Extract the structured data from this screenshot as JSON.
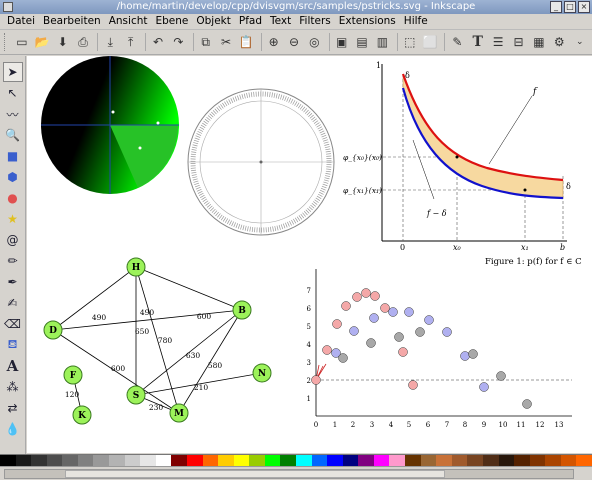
{
  "window": {
    "title": "/home/martin/develop/cpp/dvisvgm/src/samples/pstricks.svg - Inkscape"
  },
  "menu": [
    "Datei",
    "Bearbeiten",
    "Ansicht",
    "Ebene",
    "Objekt",
    "Pfad",
    "Text",
    "Filters",
    "Extensions",
    "Hilfe"
  ],
  "toolbar_icons": [
    "new-document-icon",
    "open-icon",
    "save-icon",
    "print-icon",
    "import-icon",
    "export-icon",
    "undo-icon",
    "redo-icon",
    "copy-icon",
    "cut-icon",
    "paste-icon",
    "zoom-selection-icon",
    "zoom-drawing-icon",
    "zoom-page-icon",
    "duplicate-icon",
    "clone-icon",
    "unlink-clone-icon",
    "group-icon",
    "ungroup-icon",
    "fill-stroke-icon",
    "text-icon",
    "layers-icon",
    "align-icon",
    "xml-editor-icon",
    "preferences-icon"
  ],
  "tools": [
    "selector-tool-icon",
    "node-tool-icon",
    "tweak-tool-icon",
    "zoom-tool-icon",
    "rectangle-tool-icon",
    "3d-box-tool-icon",
    "ellipse-tool-icon",
    "star-tool-icon",
    "spiral-tool-icon",
    "pencil-tool-icon",
    "pen-tool-icon",
    "calligraphy-tool-icon",
    "eraser-tool-icon",
    "paint-bucket-tool-icon",
    "text-tool-icon",
    "spray-tool-icon",
    "connector-tool-icon",
    "dropper-tool-icon"
  ],
  "palette": [
    "#000000",
    "#1a1a1a",
    "#333333",
    "#4d4d4d",
    "#666666",
    "#808080",
    "#999999",
    "#b3b3b3",
    "#cccccc",
    "#e6e6e6",
    "#ffffff",
    "#800000",
    "#ff0000",
    "#ff6600",
    "#ffcc00",
    "#ffff00",
    "#99cc00",
    "#00ff00",
    "#008000",
    "#00ffff",
    "#0066ff",
    "#0000ff",
    "#000080",
    "#800080",
    "#ff00ff",
    "#ff99cc",
    "#663300",
    "#996633",
    "#c87137",
    "#a05a2c",
    "#784421",
    "#502d16",
    "#28170b",
    "#552200",
    "#803300",
    "#aa4400",
    "#d45500",
    "#ff6600"
  ],
  "graph_plot": {
    "f_label": "f",
    "f_minus_delta": "f − δ",
    "delta": "δ",
    "y_top": "1",
    "y_labels": [
      "φ_{x₀}(x₀)",
      "φ_{x₁}(x₁)"
    ],
    "x_labels": [
      "0",
      "x₀",
      "x₁",
      "b"
    ],
    "caption": "Figure 1: p(f) for f ∈ C"
  },
  "network": {
    "nodes": [
      "H",
      "D",
      "B",
      "F",
      "S",
      "N",
      "K",
      "M"
    ],
    "edge_labels": [
      "490",
      "490",
      "600",
      "650",
      "780",
      "600",
      "630",
      "580",
      "210",
      "120",
      "230"
    ]
  },
  "scatter": {
    "x_ticks": [
      "0",
      "1",
      "2",
      "3",
      "4",
      "5",
      "6",
      "7",
      "8",
      "9",
      "10",
      "11",
      "12",
      "13"
    ],
    "y_ticks": [
      "1",
      "2",
      "3",
      "4",
      "5",
      "6",
      "7"
    ]
  }
}
